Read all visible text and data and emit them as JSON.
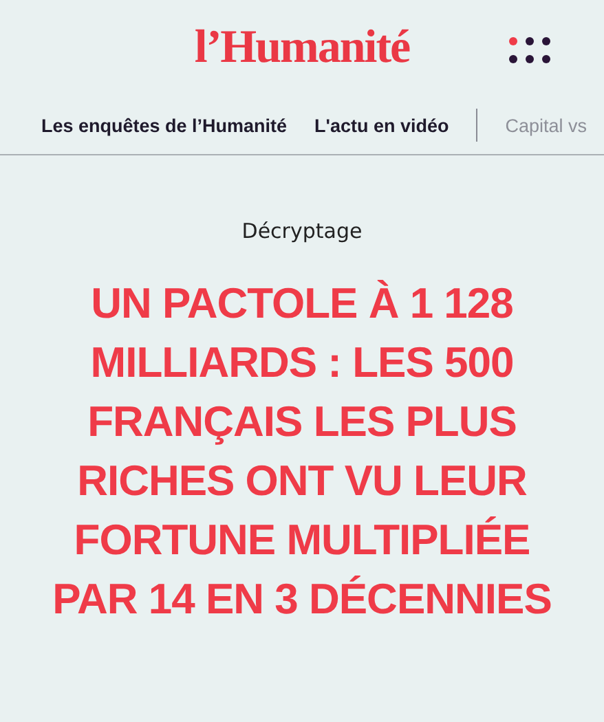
{
  "header": {
    "logo": "l’Humanité"
  },
  "nav": {
    "primary": [
      "Les enquêtes de l’Humanité",
      "L'actu en vidéo"
    ],
    "secondary": [
      "Capital vs"
    ]
  },
  "article": {
    "category": "Décryptage",
    "title": "UN PACTOLE À 1 128 MILLIARDS : LES 500 FRANÇAIS LES PLUS RICHES ONT VU LEUR FORTUNE MULTIPLIÉE PAR 14 EN 3 DÉCENNIES"
  }
}
